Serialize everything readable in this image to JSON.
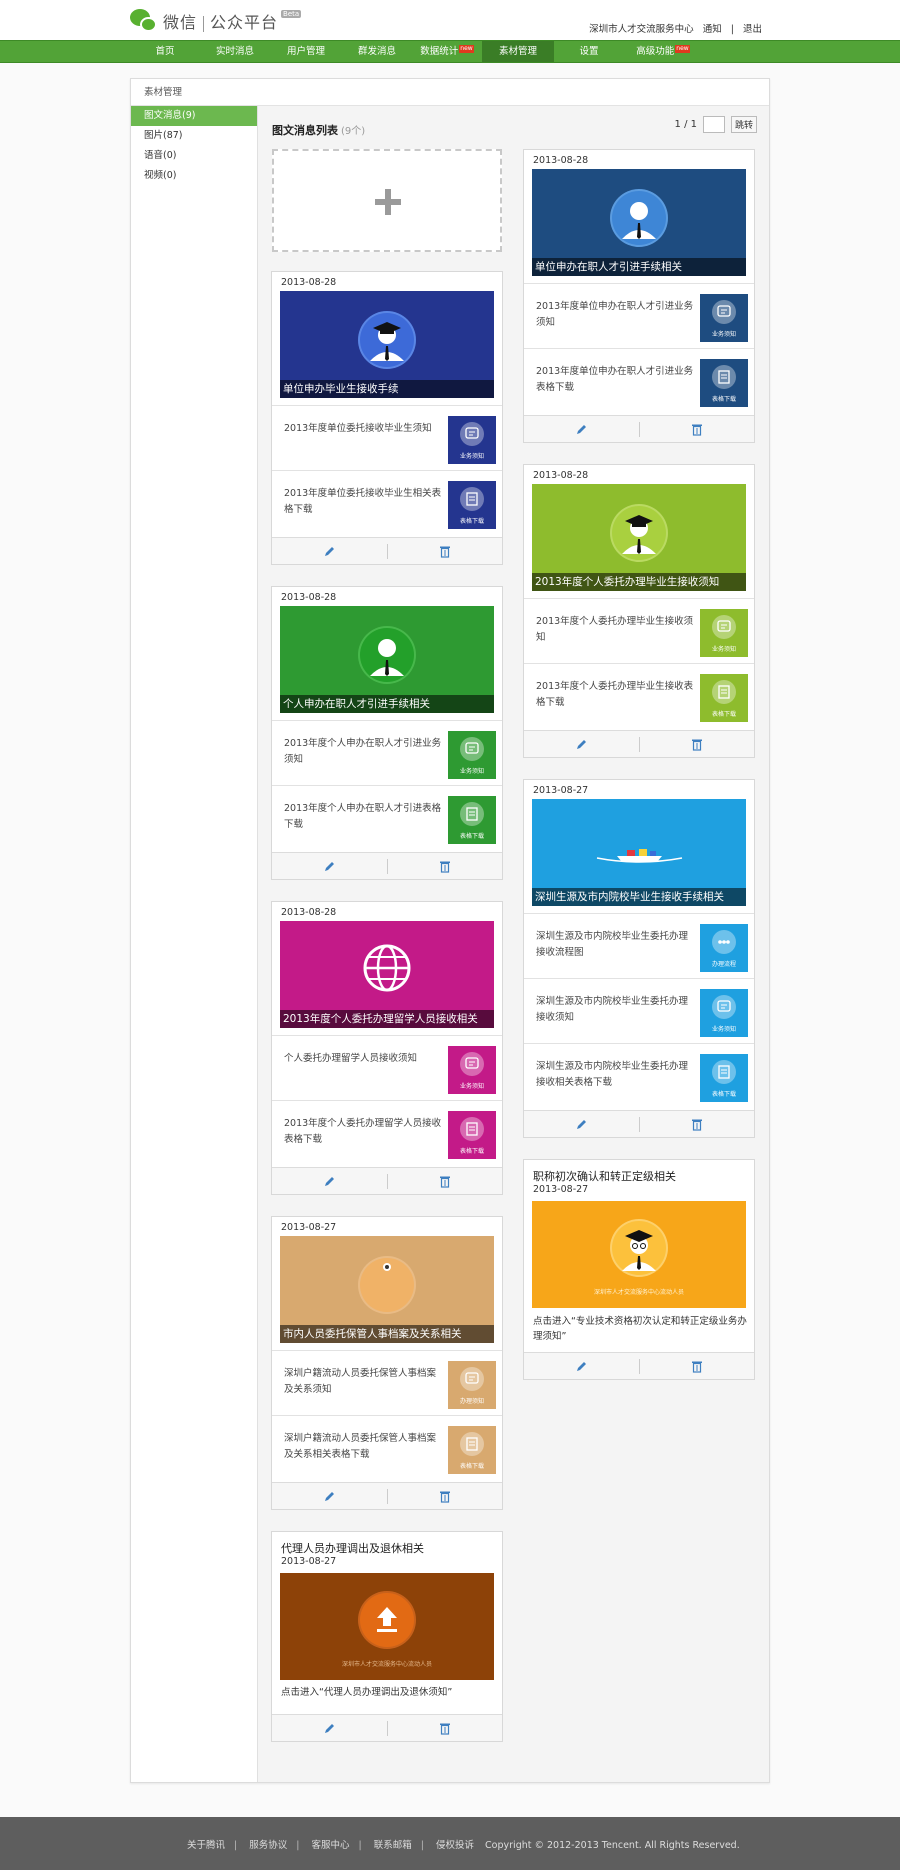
{
  "header": {
    "logo_text": "微信",
    "logo_sub": "公众平台",
    "beta": "Beta",
    "account": "深圳市人才交流服务中心",
    "notify": "通知",
    "divider": "|",
    "logout": "退出"
  },
  "nav": {
    "items": [
      {
        "label": "首页"
      },
      {
        "label": "实时消息"
      },
      {
        "label": "用户管理"
      },
      {
        "label": "群发消息"
      },
      {
        "label": "数据统计",
        "badge": "new"
      },
      {
        "label": "素材管理"
      },
      {
        "label": "设置"
      },
      {
        "label": "高级功能",
        "badge": "new"
      }
    ],
    "active": "素材管理"
  },
  "panel": {
    "title": "素材管理"
  },
  "sidebar": {
    "items": [
      {
        "label": "图文消息(9)"
      },
      {
        "label": "图片(87)"
      },
      {
        "label": "语音(0)"
      },
      {
        "label": "视频(0)"
      }
    ]
  },
  "list": {
    "title": "图文消息列表",
    "count": "(9个)",
    "page": "1 / 1",
    "jump": "跳转"
  },
  "colors": {
    "nav_green": "#52a337",
    "active_green": "#6cb84f",
    "navy": "#24358f",
    "green": "#2e9a32",
    "magenta": "#c31a88",
    "tan": "#d8a96f",
    "brown": "#8d4208",
    "steel": "#1e4c80",
    "lime": "#8ebc2d",
    "sky": "#1fa0e0",
    "amber": "#f7a619"
  },
  "cards": [
    {
      "date": "2013-08-28",
      "cover_title": "单位申办毕业生接收手续",
      "items": [
        {
          "text": "2013年度单位委托接收毕业生须知",
          "thumb": "业务须知"
        },
        {
          "text": "2013年度单位委托接收毕业生相关表格下载",
          "thumb": "表格下载"
        }
      ]
    },
    {
      "date": "2013-08-28",
      "cover_title": "个人申办在职人才引进手续相关",
      "items": [
        {
          "text": "2013年度个人申办在职人才引进业务须知",
          "thumb": "业务须知"
        },
        {
          "text": "2013年度个人申办在职人才引进表格下载",
          "thumb": "表格下载"
        }
      ]
    },
    {
      "date": "2013-08-28",
      "cover_title": "2013年度个人委托办理留学人员接收相关",
      "items": [
        {
          "text": "个人委托办理留学人员接收须知",
          "thumb": "业务须知"
        },
        {
          "text": "2013年度个人委托办理留学人员接收表格下载",
          "thumb": "表格下载"
        }
      ]
    },
    {
      "date": "2013-08-27",
      "cover_title": "市内人员委托保管人事档案及关系相关",
      "items": [
        {
          "text": "深圳户籍流动人员委托保管人事档案及关系须知",
          "thumb": "办理须知"
        },
        {
          "text": "深圳户籍流动人员委托保管人事档案及关系相关表格下载",
          "thumb": "表格下载"
        }
      ]
    },
    {
      "title": "代理人员办理调出及退休相关",
      "date": "2013-08-27",
      "desc": "点击进入“代理人员办理调出及退休须知”",
      "cover_text": "深圳市人才交流服务中心流动人员"
    },
    {
      "date": "2013-08-28",
      "cover_title": "单位申办在职人才引进手续相关",
      "items": [
        {
          "text": "2013年度单位申办在职人才引进业务须知",
          "thumb": "业务须知"
        },
        {
          "text": "2013年度单位申办在职人才引进业务表格下载",
          "thumb": "表格下载"
        }
      ]
    },
    {
      "date": "2013-08-28",
      "cover_title": "2013年度个人委托办理毕业生接收须知",
      "items": [
        {
          "text": "2013年度个人委托办理毕业生接收须知",
          "thumb": "业务须知"
        },
        {
          "text": "2013年度个人委托办理毕业生接收表格下载",
          "thumb": "表格下载"
        }
      ]
    },
    {
      "date": "2013-08-27",
      "cover_title": "深圳生源及市内院校毕业生接收手续相关",
      "items": [
        {
          "text": "深圳生源及市内院校毕业生委托办理接收流程图",
          "thumb": "办理流程"
        },
        {
          "text": "深圳生源及市内院校毕业生委托办理接收须知",
          "thumb": "业务须知"
        },
        {
          "text": "深圳生源及市内院校毕业生委托办理接收相关表格下载",
          "thumb": "表格下载"
        }
      ]
    },
    {
      "title": "职称初次确认和转正定级相关",
      "date": "2013-08-27",
      "desc": "点击进入“专业技术资格初次认定和转正定级业务办理须知”",
      "cover_text": "深圳市人才交流服务中心流动人员"
    }
  ],
  "footer": {
    "links": [
      "关于腾讯",
      "服务协议",
      "客服中心",
      "联系邮箱",
      "侵权投诉"
    ],
    "separator": "|",
    "copyright": "Copyright © 2012-2013 Tencent. All Rights Reserved."
  }
}
